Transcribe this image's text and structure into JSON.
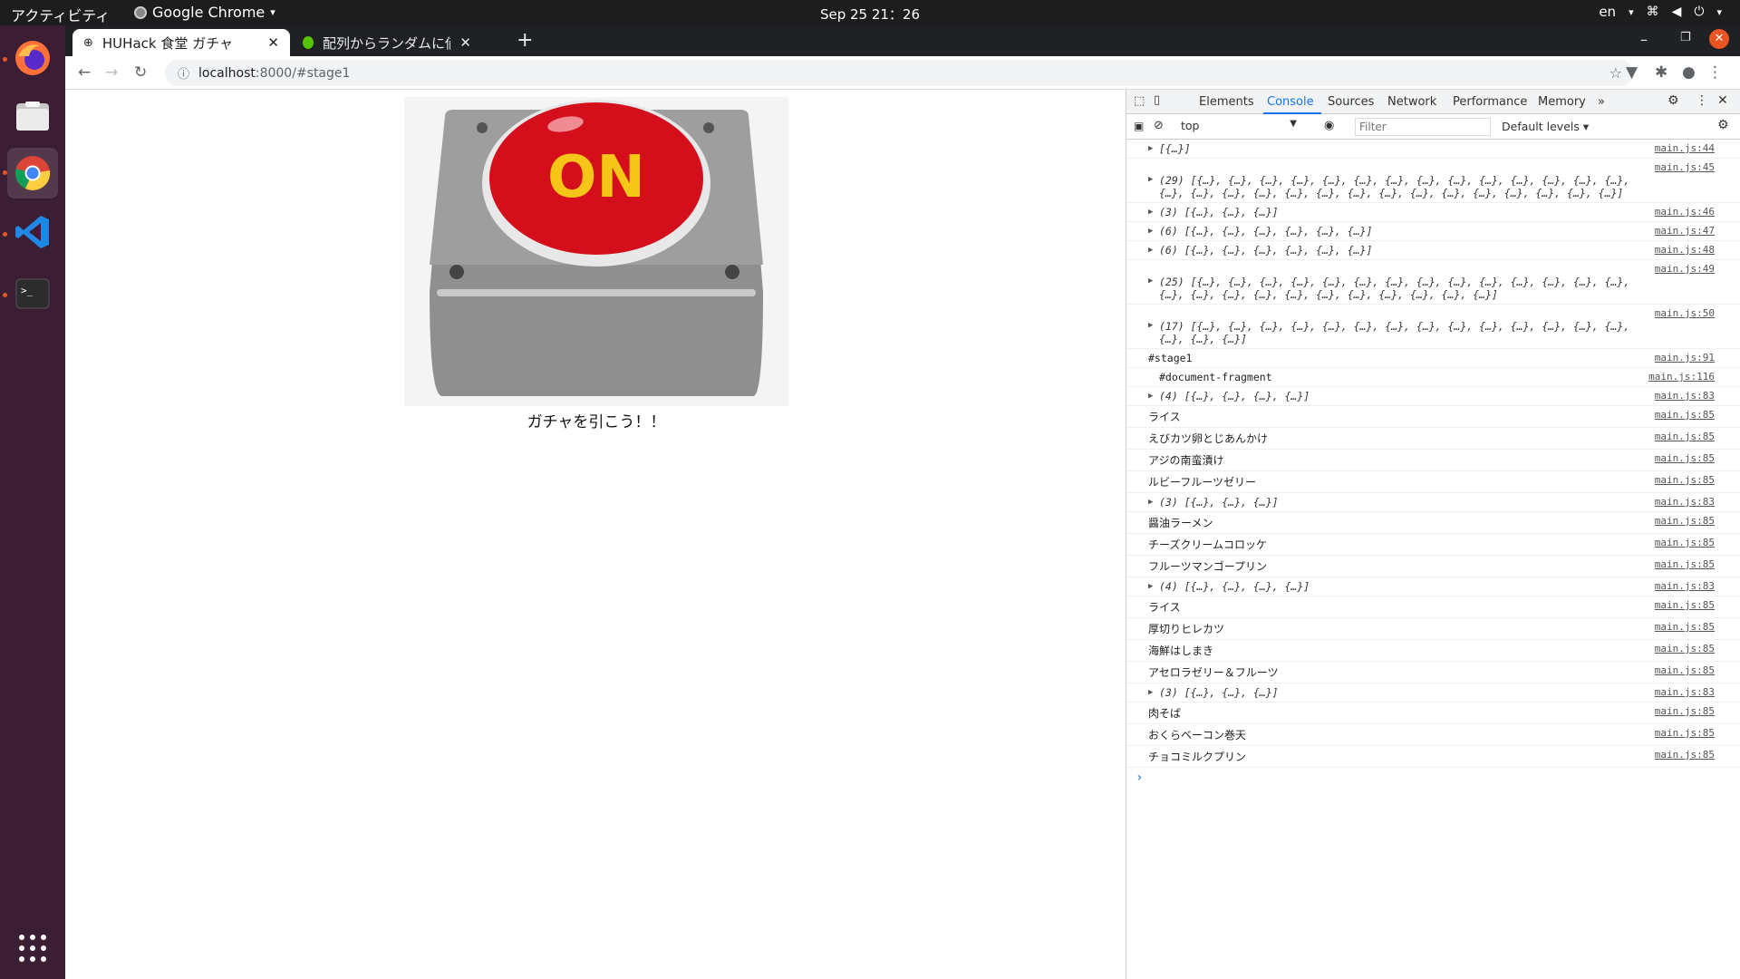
{
  "topbar": {
    "activities": "アクティビティ",
    "app_name": "Google Chrome",
    "clock": "Sep 25  21：26",
    "lang": "en"
  },
  "dock": {
    "icons": [
      "firefox-icon",
      "files-icon",
      "chrome-icon",
      "vscode-icon",
      "terminal-icon",
      "app-grid-icon"
    ]
  },
  "browser": {
    "tabs": [
      {
        "title": "HUHack 食堂 ガチャ",
        "close": "✕"
      },
      {
        "title": "配列からランダムに値を",
        "close": "✕"
      }
    ],
    "new_tab": "+",
    "url_host": "localhost",
    "url_path": ":8000/#stage1"
  },
  "page": {
    "button_label": "ON",
    "caption": "ガチャを引こう！！"
  },
  "devtools": {
    "tabs": [
      "Elements",
      "Console",
      "Sources",
      "Network",
      "Performance",
      "Memory",
      "»"
    ],
    "active_tab": "Console",
    "context": "top",
    "filter_placeholder": "Filter",
    "levels": "Default levels ▾",
    "console": [
      {
        "arrow": true,
        "text": "[{…}]",
        "src": "main.js:44",
        "italic": true
      },
      {
        "arrow": true,
        "text": "(29) [{…}, {…}, {…}, {…}, {…}, {…}, {…}, {…}, {…}, {…}, {…}, {…}, {…}, {…}, {…}, {…}, {…}, {…}, {…}, {…}, {…}, {…}, {…}, {…}, {…}, {…}, {…}, {…}, {…}]",
        "src": "main.js:45",
        "italic": true,
        "tall": true
      },
      {
        "arrow": true,
        "text": "(3) [{…}, {…}, {…}]",
        "src": "main.js:46",
        "italic": true
      },
      {
        "arrow": true,
        "text": "(6) [{…}, {…}, {…}, {…}, {…}, {…}]",
        "src": "main.js:47",
        "italic": true
      },
      {
        "arrow": true,
        "text": "(6) [{…}, {…}, {…}, {…}, {…}, {…}]",
        "src": "main.js:48",
        "italic": true
      },
      {
        "arrow": true,
        "text": "(25) [{…}, {…}, {…}, {…}, {…}, {…}, {…}, {…}, {…}, {…}, {…}, {…}, {…}, {…}, {…}, {…}, {…}, {…}, {…}, {…}, {…}, {…}, {…}, {…}, {…}]",
        "src": "main.js:49",
        "italic": true,
        "tall": true
      },
      {
        "arrow": true,
        "text": "(17) [{…}, {…}, {…}, {…}, {…}, {…}, {…}, {…}, {…}, {…}, {…}, {…}, {…}, {…}, {…}, {…}, {…}]",
        "src": "main.js:50",
        "italic": true,
        "tall": true
      },
      {
        "arrow": false,
        "text": "#stage1",
        "src": "main.js:91",
        "mono": true
      },
      {
        "arrow": false,
        "text": "  #document-fragment",
        "src": "main.js:116",
        "mono": true,
        "indent": true
      },
      {
        "arrow": true,
        "text": "(4) [{…}, {…}, {…}, {…}]",
        "src": "main.js:83",
        "italic": true
      },
      {
        "arrow": false,
        "text": "ライス",
        "src": "main.js:85"
      },
      {
        "arrow": false,
        "text": "えびカツ卵とじあんかけ",
        "src": "main.js:85"
      },
      {
        "arrow": false,
        "text": "アジの南蛮漬け",
        "src": "main.js:85"
      },
      {
        "arrow": false,
        "text": "ルビーフルーツゼリー",
        "src": "main.js:85"
      },
      {
        "arrow": true,
        "text": "(3) [{…}, {…}, {…}]",
        "src": "main.js:83",
        "italic": true
      },
      {
        "arrow": false,
        "text": "醤油ラーメン",
        "src": "main.js:85"
      },
      {
        "arrow": false,
        "text": "チーズクリームコロッケ",
        "src": "main.js:85"
      },
      {
        "arrow": false,
        "text": "フルーツマンゴープリン",
        "src": "main.js:85"
      },
      {
        "arrow": true,
        "text": "(4) [{…}, {…}, {…}, {…}]",
        "src": "main.js:83",
        "italic": true
      },
      {
        "arrow": false,
        "text": "ライス",
        "src": "main.js:85"
      },
      {
        "arrow": false,
        "text": "厚切りヒレカツ",
        "src": "main.js:85"
      },
      {
        "arrow": false,
        "text": "海鮮はしまき",
        "src": "main.js:85"
      },
      {
        "arrow": false,
        "text": "アセロラゼリー＆フルーツ",
        "src": "main.js:85"
      },
      {
        "arrow": true,
        "text": "(3) [{…}, {…}, {…}]",
        "src": "main.js:83",
        "italic": true
      },
      {
        "arrow": false,
        "text": "肉そば",
        "src": "main.js:85"
      },
      {
        "arrow": false,
        "text": "おくらベーコン巻天",
        "src": "main.js:85"
      },
      {
        "arrow": false,
        "text": "チョコミルクプリン",
        "src": "main.js:85"
      }
    ],
    "prompt": "›"
  },
  "colors": {
    "dock_bg": "#3b1e33",
    "accent": "#e95420",
    "devtools_accent": "#1a73e8",
    "button_red": "#d40f1b",
    "button_text": "#f5c518"
  }
}
